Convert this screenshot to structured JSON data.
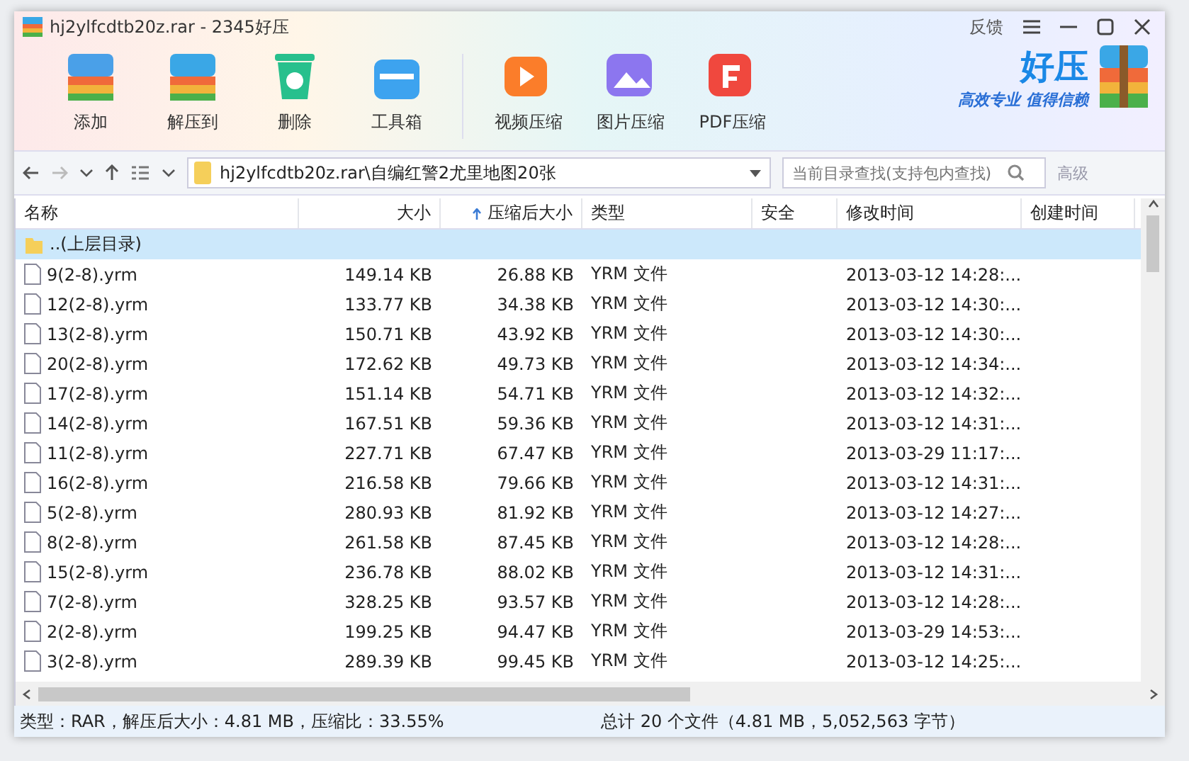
{
  "window": {
    "title": "hj2ylfcdtb20z.rar - 2345好压",
    "feedback": "反馈"
  },
  "toolbar": [
    {
      "label": "添加",
      "kind": "add"
    },
    {
      "label": "解压到",
      "kind": "extract"
    },
    {
      "label": "删除",
      "kind": "delete"
    },
    {
      "label": "工具箱",
      "kind": "tools"
    },
    {
      "label": "视频压缩",
      "kind": "video"
    },
    {
      "label": "图片压缩",
      "kind": "image"
    },
    {
      "label": "PDF压缩",
      "kind": "pdf"
    }
  ],
  "brand": {
    "name": "好压",
    "slogan": "高效专业 值得信赖"
  },
  "nav": {
    "path": "hj2ylfcdtb20z.rar\\自编红警2尤里地图20张",
    "search": {
      "placeholder": "当前目录查找(支持包内查找)"
    },
    "advanced": "高级"
  },
  "table": {
    "columns": [
      {
        "label": "名称",
        "sorted": false
      },
      {
        "label": "大小",
        "sorted": false
      },
      {
        "label": "压缩后大小",
        "sorted": true
      },
      {
        "label": "类型",
        "sorted": false
      },
      {
        "label": "安全",
        "sorted": false
      },
      {
        "label": "修改时间",
        "sorted": false
      },
      {
        "label": "创建时间",
        "sorted": false
      }
    ],
    "rows": [
      {
        "kind": "parent",
        "name": "..(上层目录)",
        "selected": true
      },
      {
        "kind": "file",
        "name": "9(2-8).yrm",
        "size": "149.14 KB",
        "packed": "26.88 KB",
        "type": "YRM 文件",
        "modified": "2013-03-12 14:28:...",
        "selected": false
      },
      {
        "kind": "file",
        "name": "12(2-8).yrm",
        "size": "133.77 KB",
        "packed": "34.38 KB",
        "type": "YRM 文件",
        "modified": "2013-03-12 14:30:...",
        "selected": false
      },
      {
        "kind": "file",
        "name": "13(2-8).yrm",
        "size": "150.71 KB",
        "packed": "43.92 KB",
        "type": "YRM 文件",
        "modified": "2013-03-12 14:30:...",
        "selected": false
      },
      {
        "kind": "file",
        "name": "20(2-8).yrm",
        "size": "172.62 KB",
        "packed": "49.73 KB",
        "type": "YRM 文件",
        "modified": "2013-03-12 14:34:...",
        "selected": false
      },
      {
        "kind": "file",
        "name": "17(2-8).yrm",
        "size": "151.14 KB",
        "packed": "54.71 KB",
        "type": "YRM 文件",
        "modified": "2013-03-12 14:32:...",
        "selected": false
      },
      {
        "kind": "file",
        "name": "14(2-8).yrm",
        "size": "167.51 KB",
        "packed": "59.36 KB",
        "type": "YRM 文件",
        "modified": "2013-03-12 14:31:...",
        "selected": false
      },
      {
        "kind": "file",
        "name": "11(2-8).yrm",
        "size": "227.71 KB",
        "packed": "67.47 KB",
        "type": "YRM 文件",
        "modified": "2013-03-29 11:17:...",
        "selected": false
      },
      {
        "kind": "file",
        "name": "16(2-8).yrm",
        "size": "216.58 KB",
        "packed": "79.66 KB",
        "type": "YRM 文件",
        "modified": "2013-03-12 14:31:...",
        "selected": false
      },
      {
        "kind": "file",
        "name": "5(2-8).yrm",
        "size": "280.93 KB",
        "packed": "81.92 KB",
        "type": "YRM 文件",
        "modified": "2013-03-12 14:27:...",
        "selected": false
      },
      {
        "kind": "file",
        "name": "8(2-8).yrm",
        "size": "261.58 KB",
        "packed": "87.45 KB",
        "type": "YRM 文件",
        "modified": "2013-03-12 14:28:...",
        "selected": false
      },
      {
        "kind": "file",
        "name": "15(2-8).yrm",
        "size": "236.78 KB",
        "packed": "88.02 KB",
        "type": "YRM 文件",
        "modified": "2013-03-12 14:31:...",
        "selected": false
      },
      {
        "kind": "file",
        "name": "7(2-8).yrm",
        "size": "328.25 KB",
        "packed": "93.57 KB",
        "type": "YRM 文件",
        "modified": "2013-03-12 14:28:...",
        "selected": false
      },
      {
        "kind": "file",
        "name": "2(2-8).yrm",
        "size": "199.25 KB",
        "packed": "94.47 KB",
        "type": "YRM 文件",
        "modified": "2013-03-29 14:53:...",
        "selected": false
      },
      {
        "kind": "file",
        "name": "3(2-8).yrm",
        "size": "289.39 KB",
        "packed": "99.45 KB",
        "type": "YRM 文件",
        "modified": "2013-03-12 14:25:...",
        "selected": false
      }
    ]
  },
  "status_bar": {
    "left": "类型：RAR，解压后大小：4.81 MB，压缩比：33.55%",
    "right": "总计 20 个文件（4.81 MB，5,052,563 字节）"
  }
}
